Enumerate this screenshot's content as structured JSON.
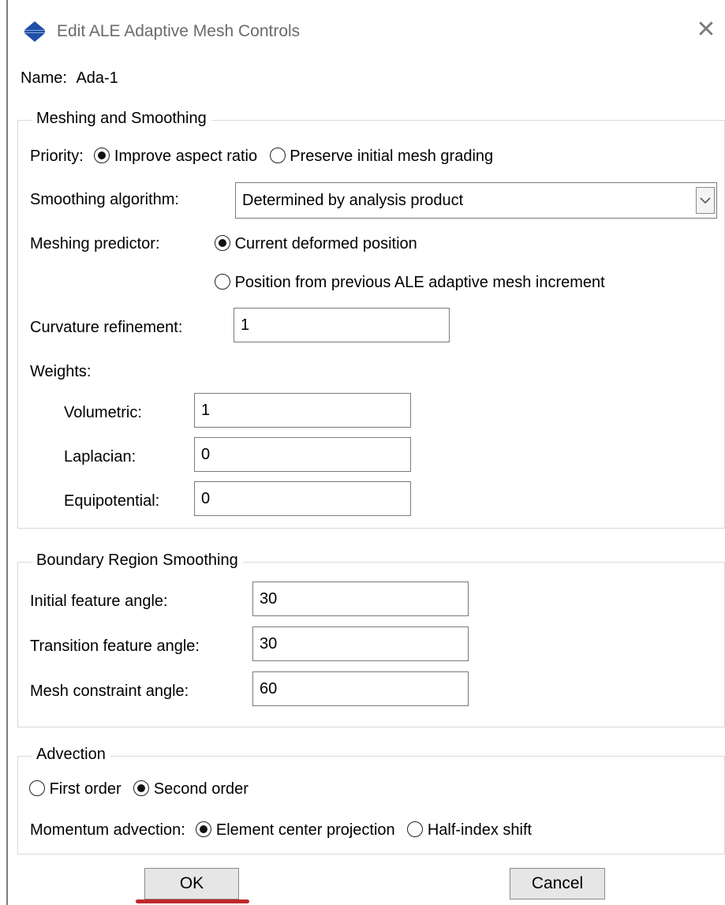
{
  "window": {
    "title": "Edit ALE Adaptive Mesh Controls"
  },
  "name": {
    "label": "Name:",
    "value": "Ada-1"
  },
  "meshing": {
    "legend": "Meshing and Smoothing",
    "priority_label": "Priority:",
    "priority_options": [
      "Improve aspect ratio",
      "Preserve initial mesh grading"
    ],
    "priority_selected": 0,
    "smoothing_label": "Smoothing algorithm:",
    "smoothing_value": "Determined by analysis product",
    "predictor_label": "Meshing predictor:",
    "predictor_options": [
      "Current deformed position",
      "Position from previous ALE adaptive mesh increment"
    ],
    "predictor_selected": 0,
    "curvature_label": "Curvature refinement:",
    "curvature_value": "1",
    "weights_label": "Weights:",
    "volumetric_label": "Volumetric:",
    "volumetric_value": "1",
    "laplacian_label": "Laplacian:",
    "laplacian_value": "0",
    "equipotential_label": "Equipotential:",
    "equipotential_value": "0"
  },
  "boundary": {
    "legend": "Boundary Region Smoothing",
    "initial_label": "Initial feature angle:",
    "initial_value": "30",
    "transition_label": "Transition feature angle:",
    "transition_value": "30",
    "constraint_label": "Mesh constraint angle:",
    "constraint_value": "60"
  },
  "advection": {
    "legend": "Advection",
    "order_options": [
      "First order",
      "Second order"
    ],
    "order_selected": 1,
    "momentum_label": "Momentum advection:",
    "momentum_options": [
      "Element center projection",
      "Half-index shift"
    ],
    "momentum_selected": 0
  },
  "buttons": {
    "ok": "OK",
    "cancel": "Cancel"
  },
  "icons": {
    "app": "abaqus-diamond-icon",
    "close": "close-icon",
    "dropdown": "chevron-down-icon"
  },
  "colors": {
    "app_icon": "#1f4fa8",
    "ok_focus": "#c1272d"
  }
}
